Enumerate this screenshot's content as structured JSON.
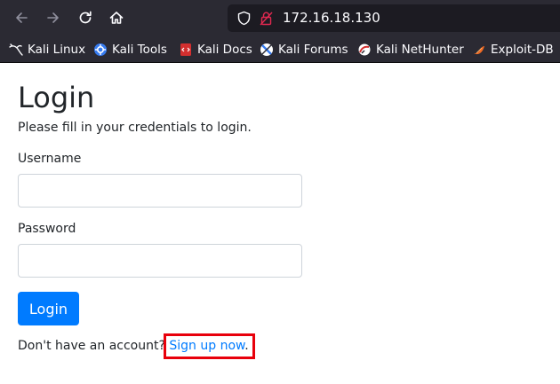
{
  "browser": {
    "url": "172.16.18.130",
    "bookmarks": [
      {
        "label": "Kali Linux",
        "icon": "kali-dragon-icon"
      },
      {
        "label": "Kali Tools",
        "icon": "kali-tools-icon"
      },
      {
        "label": "Kali Docs",
        "icon": "kali-docs-icon"
      },
      {
        "label": "Kali Forums",
        "icon": "kali-forums-icon"
      },
      {
        "label": "Kali NetHunter",
        "icon": "kali-nethunter-icon"
      },
      {
        "label": "Exploit-DB",
        "icon": "exploit-db-icon"
      }
    ]
  },
  "page": {
    "title": "Login",
    "subtitle": "Please fill in your credentials to login.",
    "username_label": "Username",
    "username_value": "",
    "password_label": "Password",
    "password_value": "",
    "login_button": "Login",
    "signup_prompt": "Don't have an account? ",
    "signup_link": "Sign up now",
    "signup_suffix": "."
  },
  "colors": {
    "accent": "#007bff",
    "highlight_box": "#e8000b",
    "chrome_bg": "#2b2a33"
  }
}
